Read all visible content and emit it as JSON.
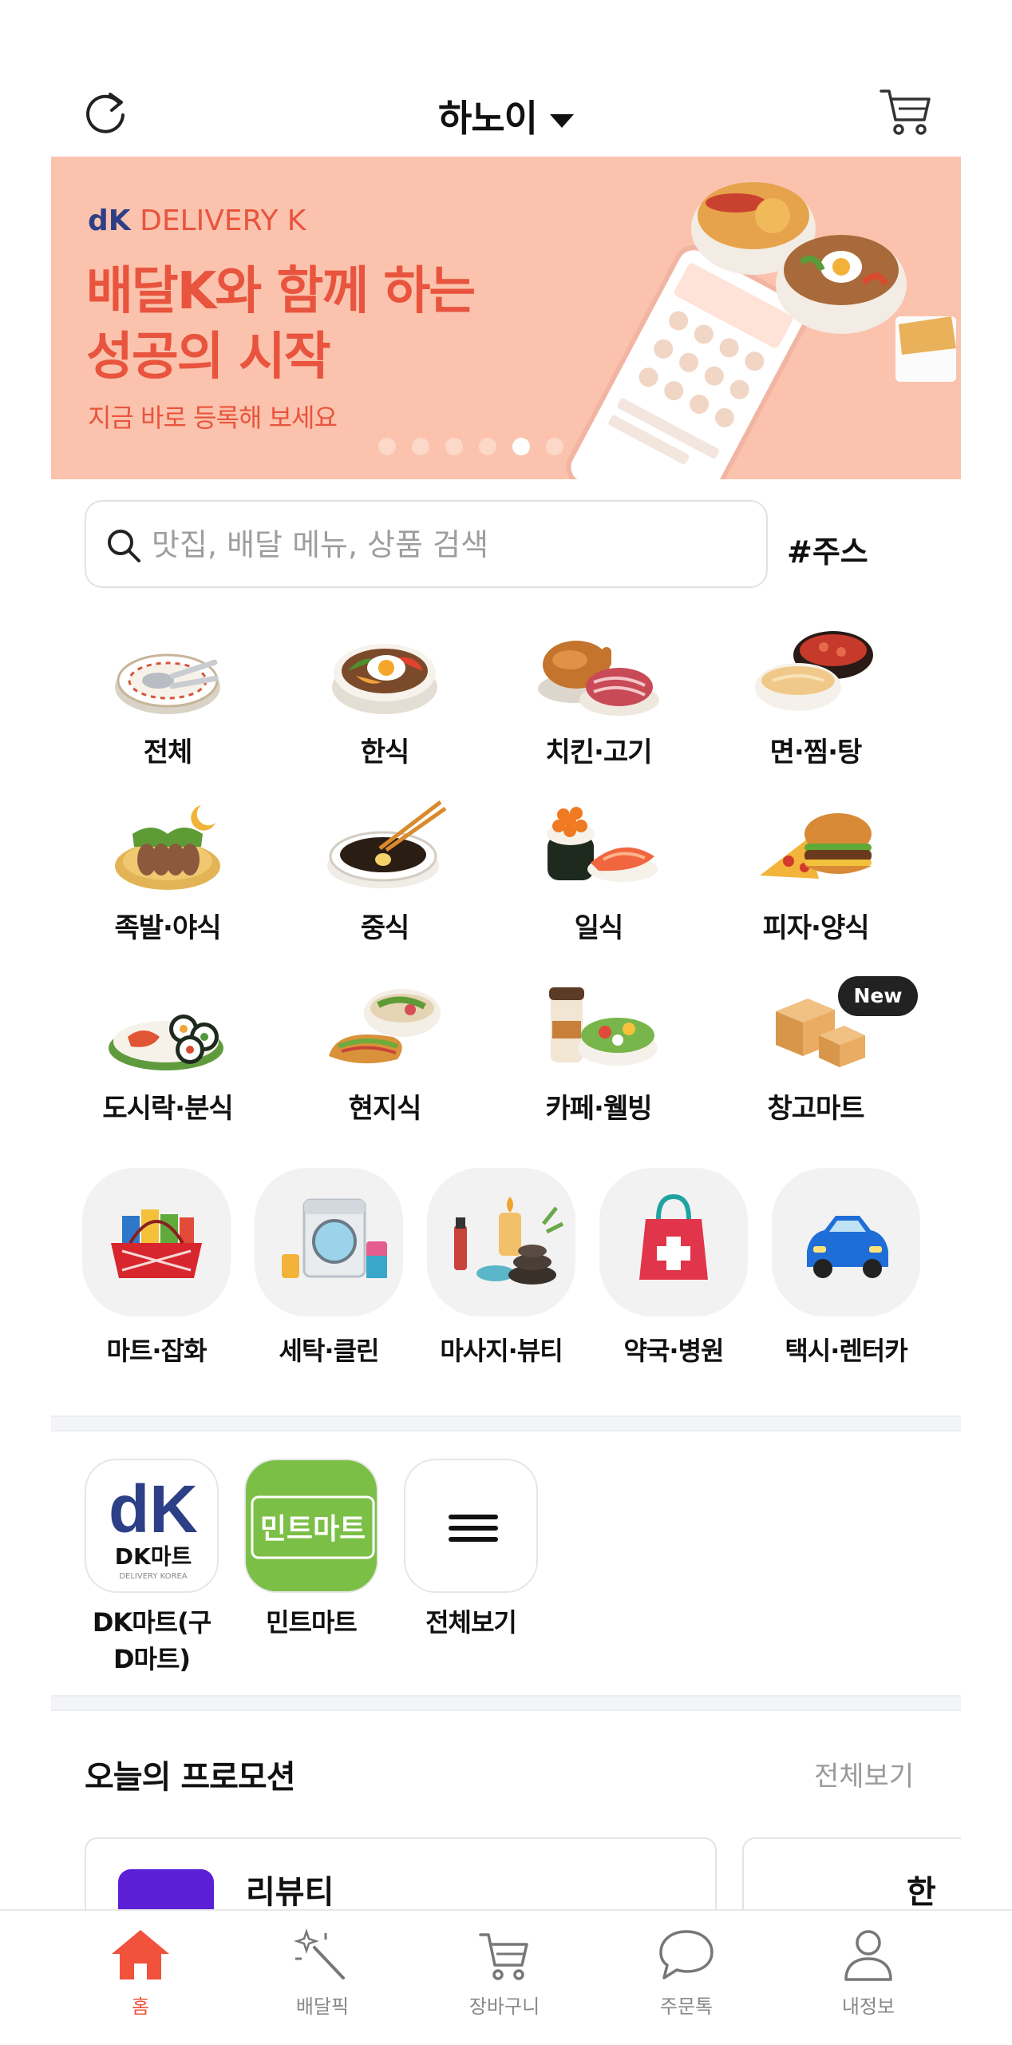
{
  "header": {
    "city": "하노이",
    "icons": [
      "refresh-icon",
      "chevron-down-icon",
      "cart-icon"
    ]
  },
  "banner": {
    "brand_prefix": "dK",
    "brand_name": "DELIVERY K",
    "headline_line1": "배달K와 함께 하는",
    "headline_line2": "성공의 시작",
    "sub": "지금 바로 등록해 보세요",
    "slide_count": 8,
    "active_slide_index": 4,
    "colors": {
      "background": "#fbc3ad",
      "accent": "#e8543e",
      "brand_blue": "#2d3f86"
    }
  },
  "search": {
    "placeholder": "맛집, 배달 메뉴, 상품 검색",
    "value": "",
    "hashtag": "#주스"
  },
  "categories": [
    {
      "label": "전체",
      "icon": "all-plate-icon"
    },
    {
      "label": "한식",
      "icon": "bibimbap-icon"
    },
    {
      "label": "치킨·고기",
      "icon": "chicken-meat-icon"
    },
    {
      "label": "면·찜·탕",
      "icon": "noodle-soup-icon"
    },
    {
      "label": "족발·야식",
      "icon": "jokbal-icon"
    },
    {
      "label": "중식",
      "icon": "jjajang-icon"
    },
    {
      "label": "일식",
      "icon": "sushi-icon"
    },
    {
      "label": "피자·양식",
      "icon": "pizza-burger-icon"
    },
    {
      "label": "도시락·분식",
      "icon": "kimbap-icon"
    },
    {
      "label": "현지식",
      "icon": "banhmi-pho-icon"
    },
    {
      "label": "카페·웰빙",
      "icon": "cafe-salad-icon"
    },
    {
      "label": "창고마트",
      "icon": "boxes-icon",
      "badge": "New"
    }
  ],
  "services": [
    {
      "label": "마트·잡화",
      "icon": "grocery-basket-icon"
    },
    {
      "label": "세탁·클린",
      "icon": "washing-machine-icon"
    },
    {
      "label": "마사지·뷰티",
      "icon": "spa-icon"
    },
    {
      "label": "약국·병원",
      "icon": "pharmacy-bag-icon"
    },
    {
      "label": "택시·렌터카",
      "icon": "car-icon"
    }
  ],
  "shops": [
    {
      "label_line1": "DK마트(구",
      "label_line2": "D마트)",
      "logo_text": "DK마트",
      "logo_sub": "DELIVERY KOREA",
      "logo_mark": "dK"
    },
    {
      "label_line1": "민트마트",
      "label_line2": "",
      "logo_text": "민트마트"
    },
    {
      "label_line1": "전체보기",
      "label_line2": "",
      "icon": "menu-icon"
    }
  ],
  "promotion": {
    "title": "오늘의 프로모션",
    "view_all": "전체보기",
    "cards": [
      {
        "name": "리뷰티"
      },
      {
        "name": "한끼"
      }
    ]
  },
  "bottom_nav": {
    "active": "홈",
    "items": [
      {
        "label": "홈",
        "icon": "home-icon"
      },
      {
        "label": "배달픽",
        "icon": "magic-wand-icon"
      },
      {
        "label": "장바구니",
        "icon": "cart-icon"
      },
      {
        "label": "주문톡",
        "icon": "chat-bubble-icon"
      },
      {
        "label": "내정보",
        "icon": "user-icon"
      }
    ],
    "colors": {
      "active": "#f0523c",
      "inactive": "#888888"
    }
  }
}
